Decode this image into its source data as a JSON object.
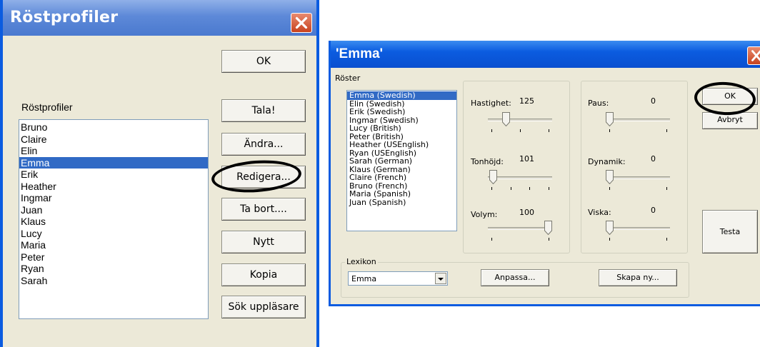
{
  "profiles_window": {
    "title": "Röstprofiler",
    "list_label": "Röstprofiler",
    "profiles": [
      "Bruno",
      "Claire",
      "Elin",
      "Emma",
      "Erik",
      "Heather",
      "Ingmar",
      "Juan",
      "Klaus",
      "Lucy",
      "Maria",
      "Peter",
      "Ryan",
      "Sarah"
    ],
    "selected": "Emma",
    "buttons": {
      "ok": "OK",
      "speak": "Tala!",
      "change": "Ändra...",
      "edit": "Redigera...",
      "delete": "Ta bort....",
      "new": "Nytt",
      "copy": "Kopia",
      "search": "Sök uppläsare"
    }
  },
  "voice_window": {
    "title": "'Emma'",
    "voices_label": "Röster",
    "voices": [
      "Emma (Swedish)",
      "Elin (Swedish)",
      "Erik (Swedish)",
      "Ingmar (Swedish)",
      "Lucy (British)",
      "Peter (British)",
      "Heather (USEnglish)",
      "Ryan (USEnglish)",
      "Sarah (German)",
      "Klaus (German)",
      "Claire (French)",
      "Bruno (French)",
      "Maria (Spanish)",
      "Juan (Spanish)"
    ],
    "selected_voice": "Emma (Swedish)",
    "speed": {
      "label": "Hastighet:",
      "value": "125",
      "level": 0.25
    },
    "pitch": {
      "label": "Tonhöjd:",
      "value": "101",
      "level": 0.02
    },
    "volume": {
      "label": "Volym:",
      "value": "100",
      "level": 1.0
    },
    "pause": {
      "label": "Paus:",
      "value": "0",
      "level": 0.0
    },
    "dynamics": {
      "label": "Dynamik:",
      "value": "0",
      "level": 0.0
    },
    "whisper": {
      "label": "Viska:",
      "value": "0",
      "level": 0.0
    },
    "buttons": {
      "ok": "OK",
      "cancel": "Avbryt",
      "test": "Testa",
      "adapt": "Anpassa...",
      "create_new": "Skapa ny..."
    },
    "lexicon": {
      "label": "Lexikon",
      "value": "Emma"
    }
  },
  "colors": {
    "xp_blue": "#0b5ce0",
    "selection": "#316ac5",
    "dialog_bg": "#ece9d8"
  }
}
